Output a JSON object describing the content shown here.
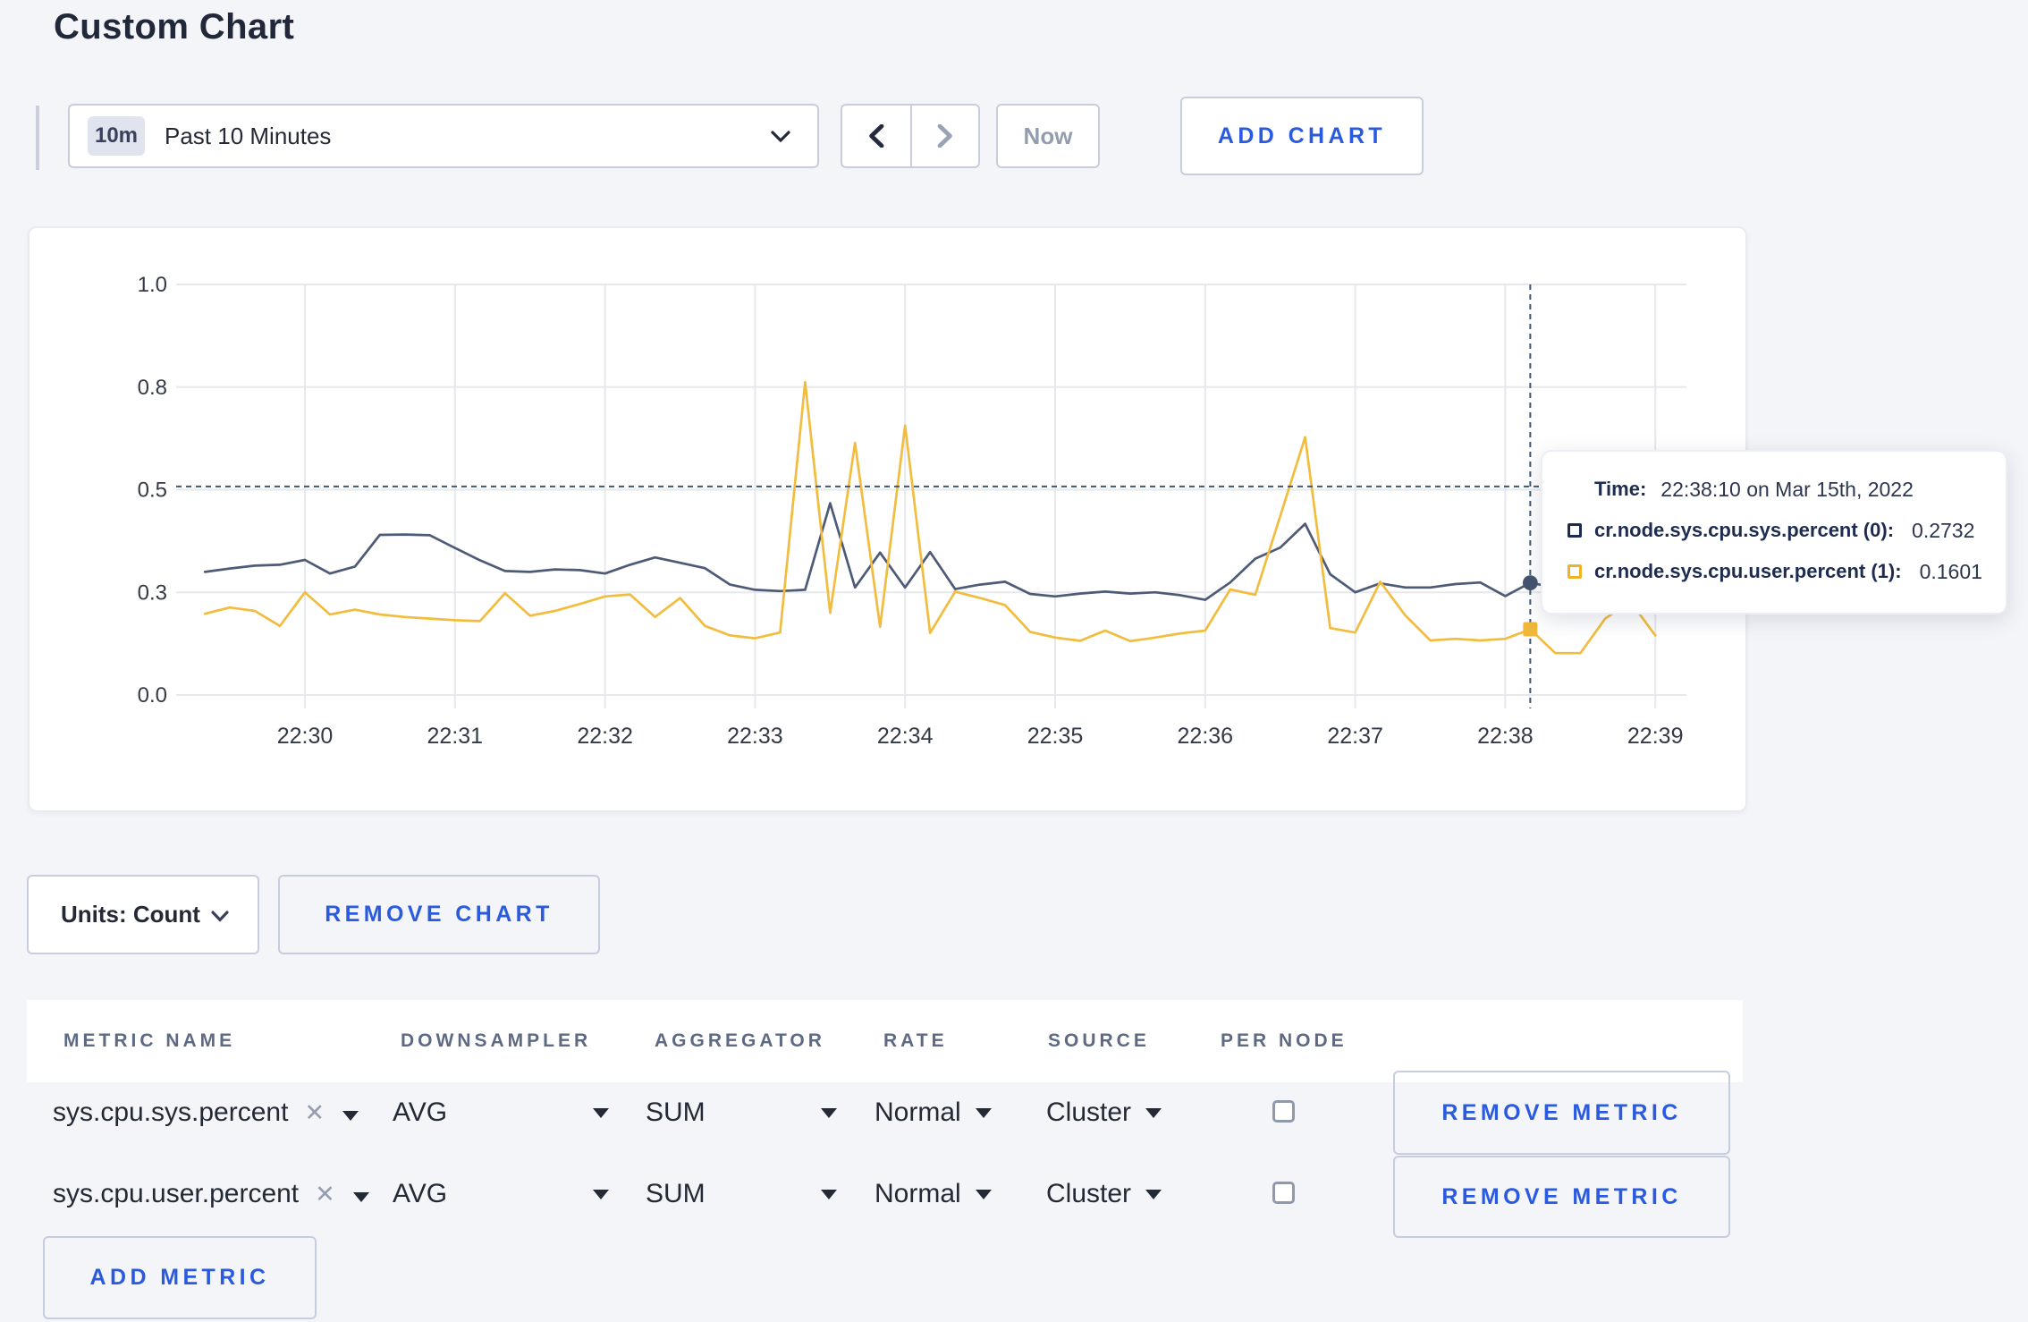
{
  "page_title": "Custom Chart",
  "toolbar": {
    "range_badge": "10m",
    "range_label": "Past 10 Minutes",
    "prev_icon": "chevron-left",
    "next_icon": "chevron-right",
    "now_label": "Now",
    "add_chart_label": "ADD CHART"
  },
  "colors": {
    "accent_blue": "#2a5adf",
    "series_sys": "#4d5b76",
    "series_user": "#f2bd3f",
    "legend_sys_square": "#1c2c50",
    "legend_user_square": "#efb32a",
    "crosshair": "#3c5a78",
    "grid": "#e7e8ec",
    "page_bg": "#f4f5f9"
  },
  "chart_data": {
    "type": "line",
    "title": "",
    "xlabel": "",
    "ylabel": "",
    "grid": true,
    "legend_position": "tooltip",
    "ylim": [
      0,
      1
    ],
    "y_ticks": [
      {
        "v": 0,
        "label": "0.0"
      },
      {
        "v": 0.25,
        "label": "0.3"
      },
      {
        "v": 0.5,
        "label": "0.5"
      },
      {
        "v": 0.75,
        "label": "0.8"
      },
      {
        "v": 1,
        "label": "1.0"
      }
    ],
    "x_ticks": [
      {
        "t": 60,
        "label": "22:30"
      },
      {
        "t": 120,
        "label": "22:31"
      },
      {
        "t": 180,
        "label": "22:32"
      },
      {
        "t": 240,
        "label": "22:33"
      },
      {
        "t": 300,
        "label": "22:34"
      },
      {
        "t": 360,
        "label": "22:35"
      },
      {
        "t": 420,
        "label": "22:36"
      },
      {
        "t": 480,
        "label": "22:37"
      },
      {
        "t": 540,
        "label": "22:38"
      },
      {
        "t": 600,
        "label": "22:39"
      }
    ],
    "x_start_seconds": 20,
    "x_step_seconds": 10,
    "x_axis_origin": "22:29:00",
    "series": [
      {
        "name": "cr.node.sys.cpu.sys.percent",
        "color": "#4d5b76",
        "values": [
          0.3,
          0.308,
          0.315,
          0.317,
          0.329,
          0.296,
          0.313,
          0.39,
          0.391,
          0.389,
          0.358,
          0.328,
          0.302,
          0.3,
          0.306,
          0.304,
          0.296,
          0.317,
          0.335,
          0.322,
          0.309,
          0.269,
          0.256,
          0.253,
          0.256,
          0.467,
          0.262,
          0.347,
          0.262,
          0.348,
          0.258,
          0.269,
          0.276,
          0.246,
          0.24,
          0.247,
          0.252,
          0.247,
          0.25,
          0.243,
          0.232,
          0.274,
          0.332,
          0.359,
          0.417,
          0.294,
          0.25,
          0.272,
          0.262,
          0.262,
          0.27,
          0.274,
          0.241,
          0.2732,
          0.262,
          0.27,
          0.272,
          0.266,
          0.262
        ]
      },
      {
        "name": "cr.node.sys.cpu.user.percent",
        "color": "#f2bd3f",
        "values": [
          0.198,
          0.213,
          0.205,
          0.168,
          0.25,
          0.196,
          0.208,
          0.196,
          0.19,
          0.186,
          0.182,
          0.18,
          0.248,
          0.193,
          0.205,
          0.222,
          0.24,
          0.245,
          0.19,
          0.236,
          0.168,
          0.145,
          0.138,
          0.152,
          0.762,
          0.2,
          0.614,
          0.166,
          0.656,
          0.151,
          0.252,
          0.236,
          0.219,
          0.154,
          0.14,
          0.132,
          0.157,
          0.131,
          0.14,
          0.15,
          0.157,
          0.257,
          0.244,
          0.436,
          0.628,
          0.163,
          0.152,
          0.276,
          0.194,
          0.133,
          0.137,
          0.133,
          0.137,
          0.1601,
          0.102,
          0.102,
          0.186,
          0.228,
          0.145
        ]
      }
    ],
    "cursor": {
      "x_seconds": 550,
      "y_value": 0.508,
      "sys_value": 0.2732,
      "user_value": 0.1601
    }
  },
  "tooltip": {
    "time_label": "Time:",
    "time_value": "22:38:10 on Mar 15th, 2022",
    "series": [
      {
        "label": "cr.node.sys.cpu.sys.percent (0):",
        "value": "0.2732"
      },
      {
        "label": "cr.node.sys.cpu.user.percent (1):",
        "value": "0.1601"
      }
    ]
  },
  "chart_controls": {
    "units_label": "Units: Count",
    "remove_chart_label": "REMOVE CHART"
  },
  "metrics_table": {
    "headers": [
      "METRIC NAME",
      "DOWNSAMPLER",
      "AGGREGATOR",
      "RATE",
      "SOURCE",
      "PER NODE"
    ],
    "rows": [
      {
        "metric": "sys.cpu.sys.percent",
        "clear_icon": "x",
        "downsampler": "AVG",
        "aggregator": "SUM",
        "rate": "Normal",
        "source": "Cluster",
        "per_node_checked": false,
        "remove_label": "REMOVE METRIC"
      },
      {
        "metric": "sys.cpu.user.percent",
        "clear_icon": "x",
        "downsampler": "AVG",
        "aggregator": "SUM",
        "rate": "Normal",
        "source": "Cluster",
        "per_node_checked": false,
        "remove_label": "REMOVE METRIC"
      }
    ],
    "add_metric_label": "ADD METRIC"
  }
}
